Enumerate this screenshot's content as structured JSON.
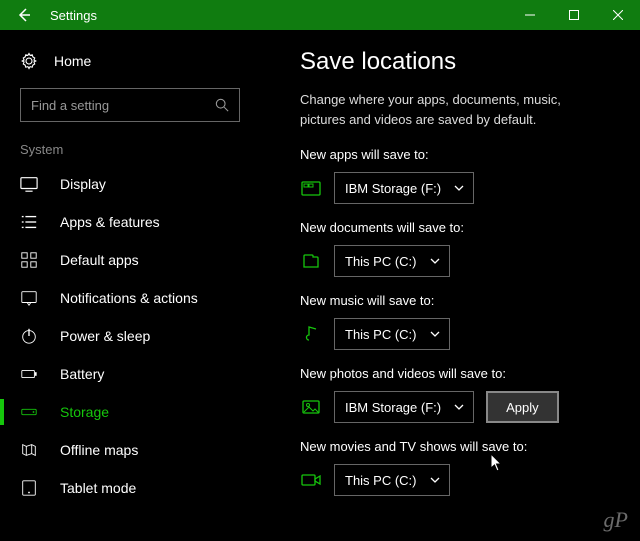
{
  "titlebar": {
    "title": "Settings"
  },
  "sidebar": {
    "home_label": "Home",
    "search_placeholder": "Find a setting",
    "section_label": "System",
    "items": [
      {
        "label": "Display"
      },
      {
        "label": "Apps & features"
      },
      {
        "label": "Default apps"
      },
      {
        "label": "Notifications & actions"
      },
      {
        "label": "Power & sleep"
      },
      {
        "label": "Battery"
      },
      {
        "label": "Storage"
      },
      {
        "label": "Offline maps"
      },
      {
        "label": "Tablet mode"
      }
    ]
  },
  "content": {
    "heading": "Save locations",
    "description": "Change where your apps, documents, music, pictures and videos are saved by default.",
    "apply_label": "Apply",
    "settings": [
      {
        "label": "New apps will save to:",
        "value": "IBM Storage (F:)"
      },
      {
        "label": "New documents will save to:",
        "value": "This PC (C:)"
      },
      {
        "label": "New music will save to:",
        "value": "This PC (C:)"
      },
      {
        "label": "New photos and videos will save to:",
        "value": "IBM Storage (F:)"
      },
      {
        "label": "New movies and TV shows will save to:",
        "value": "This PC (C:)"
      }
    ]
  },
  "watermark": "gP"
}
